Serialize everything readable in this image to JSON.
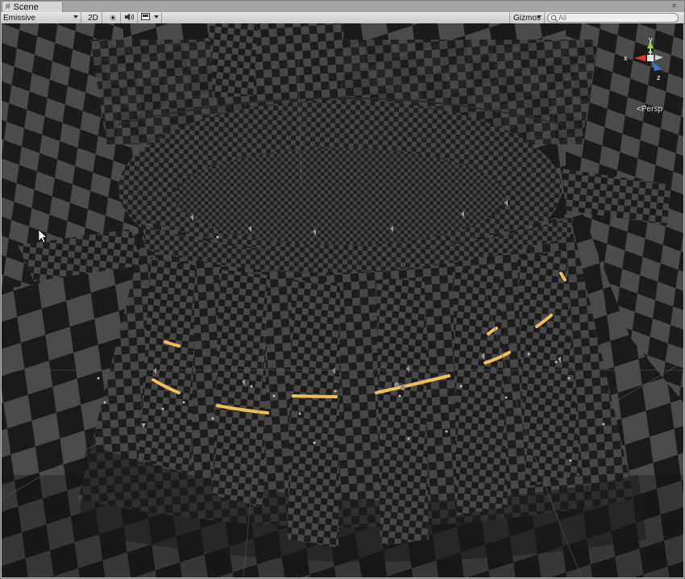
{
  "tab": {
    "title": "Scene",
    "icon": "grid-icon"
  },
  "toolbar": {
    "draw_mode": "Emissive",
    "mode_2d": "2D",
    "lighting_icon": "sun-icon",
    "audio_icon": "speaker-icon",
    "effects_icon": "image-icon",
    "gizmos": "Gizmos",
    "search_placeholder": "All"
  },
  "gizmo": {
    "y_label": "y",
    "x_label": "x",
    "z_label": "z",
    "projection": "Persp"
  },
  "colors": {
    "checker_dark": "#1a1a1a",
    "checker_light": "#4a4a4a",
    "sky": "#e8dcc4",
    "highlight": "#f0bf55",
    "axis_y": "#9ad14b",
    "axis_x": "#e03a2c",
    "axis_z": "#3a74d8"
  }
}
